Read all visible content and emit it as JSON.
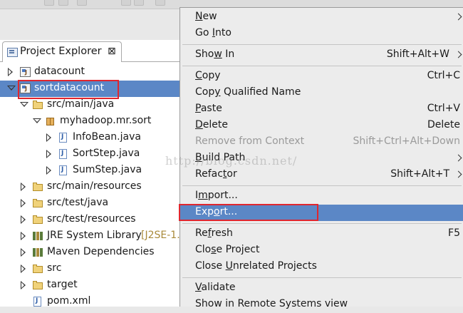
{
  "explorer": {
    "tab_title": "Project Explorer",
    "close_glyph": "⊠"
  },
  "tree": [
    {
      "label": "datacount",
      "icon": "project-icon",
      "state": "closed",
      "level": 0
    },
    {
      "label": "sortdatacount",
      "icon": "project-icon",
      "state": "open",
      "level": 0,
      "selected": true
    },
    {
      "label": "src/main/java",
      "icon": "source-folder-icon",
      "state": "open",
      "level": 1
    },
    {
      "label": "myhadoop.mr.sort",
      "icon": "package-icon",
      "state": "open",
      "level": 2
    },
    {
      "label": "InfoBean.java",
      "icon": "java-file-icon",
      "state": "closed",
      "level": 3
    },
    {
      "label": "SortStep.java",
      "icon": "java-file-icon",
      "state": "closed",
      "level": 3
    },
    {
      "label": "SumStep.java",
      "icon": "java-file-icon",
      "state": "closed",
      "level": 3
    },
    {
      "label": "src/main/resources",
      "icon": "source-folder-icon",
      "state": "closed",
      "level": 1
    },
    {
      "label": "src/test/java",
      "icon": "source-folder-icon",
      "state": "closed",
      "level": 1
    },
    {
      "label": "src/test/resources",
      "icon": "source-folder-icon",
      "state": "closed",
      "level": 1
    },
    {
      "label": "JRE System Library",
      "suffix": "[J2SE-1.",
      "icon": "library-icon",
      "state": "closed",
      "level": 1
    },
    {
      "label": "Maven Dependencies",
      "icon": "library-icon",
      "state": "closed",
      "level": 1
    },
    {
      "label": "src",
      "icon": "folder-icon",
      "state": "closed",
      "level": 1
    },
    {
      "label": "target",
      "icon": "folder-icon",
      "state": "closed",
      "level": 1
    },
    {
      "label": "pom.xml",
      "icon": "file-icon",
      "state": "none",
      "level": 1
    }
  ],
  "menu": [
    {
      "label": "New",
      "mnemonic": "N",
      "submenu": true
    },
    {
      "label": "Go Into",
      "mnemonic": "I"
    },
    {
      "sep": true
    },
    {
      "label": "Show In",
      "mnemonic": "w",
      "shortcut": "Shift+Alt+W",
      "submenu": true
    },
    {
      "sep": true
    },
    {
      "label": "Copy",
      "mnemonic": "C",
      "shortcut": "Ctrl+C"
    },
    {
      "label": "Copy Qualified Name",
      "mnemonic": "y"
    },
    {
      "label": "Paste",
      "mnemonic": "P",
      "shortcut": "Ctrl+V"
    },
    {
      "label": "Delete",
      "mnemonic": "D",
      "shortcut": "Delete"
    },
    {
      "label": "Remove from Context",
      "shortcut": "Shift+Ctrl+Alt+Down",
      "disabled": true
    },
    {
      "label": "Build Path",
      "mnemonic": "B",
      "submenu": true
    },
    {
      "label": "Refactor",
      "mnemonic": "t",
      "shortcut": "Shift+Alt+T",
      "submenu": true
    },
    {
      "sep": true
    },
    {
      "label": "Import...",
      "mnemonic": "m"
    },
    {
      "label": "Export...",
      "mnemonic": "o",
      "active": true
    },
    {
      "sep": true
    },
    {
      "label": "Refresh",
      "mnemonic": "f",
      "shortcut": "F5"
    },
    {
      "label": "Close Project",
      "mnemonic": "s"
    },
    {
      "label": "Close Unrelated Projects",
      "mnemonic": "U"
    },
    {
      "sep": true
    },
    {
      "label": "Validate",
      "mnemonic": "V"
    },
    {
      "label": "Show in Remote Systems view"
    }
  ],
  "watermark": "http://blog.csdn.net/",
  "colors": {
    "selection": "#5b87c6",
    "highlight_box": "#e0262e",
    "menu_bg": "#ececec"
  }
}
